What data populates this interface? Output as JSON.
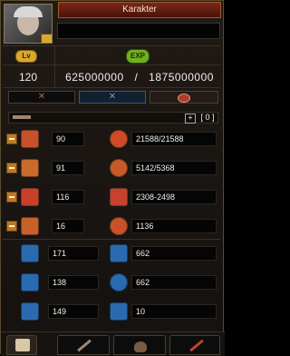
{
  "window": {
    "title": "Karakter"
  },
  "character": {
    "name": ""
  },
  "badges": {
    "level": "Lv",
    "exp": "EXP"
  },
  "level": "120",
  "exp": {
    "current": "625000000",
    "separator": "/",
    "next": "1875000000"
  },
  "stat_points": "0",
  "stats_left": [
    {
      "value": "90",
      "icon": "strength-icon",
      "color": "#c8502a"
    },
    {
      "value": "91",
      "icon": "head-icon",
      "color": "#c86a2a"
    },
    {
      "value": "116",
      "icon": "dexterity-icon",
      "color": "#c8402a"
    },
    {
      "value": "16",
      "icon": "weapon-icon",
      "color": "#c8602a"
    }
  ],
  "stats_right": [
    {
      "value": "21588/21588",
      "icon": "heart-icon",
      "color": "#d04a28"
    },
    {
      "value": "5142/5368",
      "icon": "mana-icon",
      "color": "#c85a2a"
    },
    {
      "value": "2308-2498",
      "icon": "attack-icon",
      "color": "#c84030"
    },
    {
      "value": "1136",
      "icon": "shield-icon",
      "color": "#c8502a"
    }
  ],
  "sub_left": [
    {
      "value": "171",
      "icon": "speed-icon"
    },
    {
      "value": "138",
      "icon": "magic-speed-icon"
    },
    {
      "value": "149",
      "icon": "hourglass-icon"
    }
  ],
  "sub_right": [
    {
      "value": "662",
      "icon": "tower-icon"
    },
    {
      "value": "662",
      "icon": "magic-shield-icon"
    },
    {
      "value": "10",
      "icon": "pillar-icon"
    }
  ],
  "colors": {
    "accent": "#c07820",
    "blue_icon": "#2a6ab0"
  }
}
